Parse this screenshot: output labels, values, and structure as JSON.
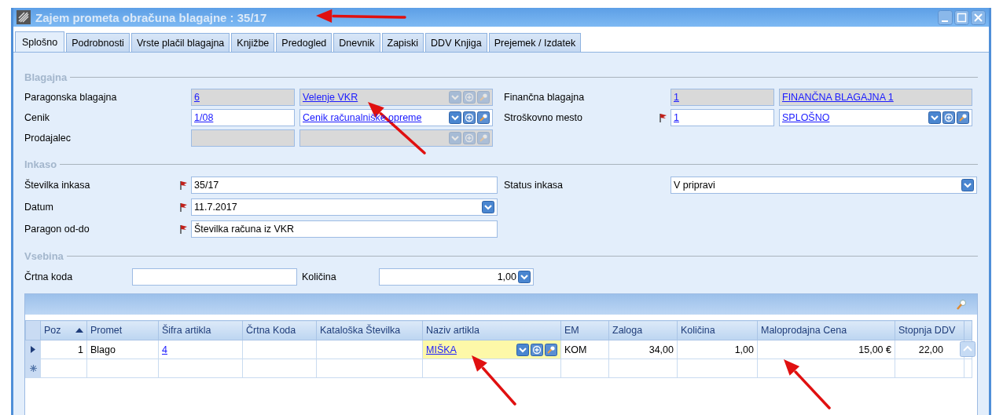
{
  "window": {
    "title": "Zajem prometa obračuna blagajne : 35/17"
  },
  "tabs": [
    {
      "label": "Splošno",
      "selected": true
    },
    {
      "label": "Podrobnosti",
      "selected": false
    },
    {
      "label": "Vrste plačil blagajna",
      "selected": false
    },
    {
      "label": "Knjižbe",
      "selected": false
    },
    {
      "label": "Predogled",
      "selected": false
    },
    {
      "label": "Dnevnik",
      "selected": false
    },
    {
      "label": "Zapiski",
      "selected": false
    },
    {
      "label": "DDV Knjiga",
      "selected": false
    },
    {
      "label": "Prejemek / Izdatek",
      "selected": false
    }
  ],
  "blagajna": {
    "title": "Blagajna",
    "fields": [
      {
        "label": "Paragonska blagajna",
        "required": false,
        "code": {
          "value": "6",
          "disabled": true
        },
        "name": {
          "value": "Velenje VKR",
          "disabled": true,
          "buttons": true
        }
      },
      {
        "label": "Finančna blagajna",
        "required": false,
        "code": {
          "value": "1",
          "disabled": true
        },
        "name": {
          "value": "FINANČNA BLAGAJNA 1",
          "disabled": true,
          "buttons": false
        }
      },
      {
        "label": "Cenik",
        "required": false,
        "code": {
          "value": "1/08",
          "disabled": false
        },
        "name": {
          "value": "Cenik računalniške opreme",
          "disabled": false,
          "buttons": true
        }
      },
      {
        "label": "Stroškovno mesto",
        "required": true,
        "code": {
          "value": "1",
          "disabled": false
        },
        "name": {
          "value": "SPLOŠNO",
          "disabled": false,
          "buttons": true
        }
      },
      {
        "label": "Prodajalec",
        "required": false,
        "code": {
          "disabled": true
        },
        "name": {
          "disabled": true,
          "buttons": true
        }
      }
    ]
  },
  "inkaso": {
    "title": "Inkaso",
    "left": [
      {
        "label": "Številka inkasa",
        "required": true,
        "kind": "text",
        "value": "35/17"
      },
      {
        "label": "Datum",
        "required": true,
        "kind": "dropdown",
        "value": "11.7.2017"
      },
      {
        "label": "Paragon od-do",
        "required": true,
        "kind": "text",
        "value": "Številka računa iz VKR"
      }
    ],
    "right": [
      {
        "label": "Status inkasa",
        "kind": "dropdown",
        "value": "V pripravi"
      }
    ]
  },
  "vsebina": {
    "title": "Vsebina",
    "barcode": {
      "label": "Črtna koda"
    },
    "quantity": {
      "label": "Količina",
      "value": "1,00"
    }
  },
  "table": {
    "columns": [
      {
        "label": "Poz",
        "sorted": true,
        "kind": "number"
      },
      {
        "label": "Promet",
        "sorted": false,
        "kind": "text"
      },
      {
        "label": "Šifra artikla",
        "sorted": false,
        "kind": "text"
      },
      {
        "label": "Črtna Koda",
        "sorted": false,
        "kind": "text"
      },
      {
        "label": "Kataloška Številka",
        "sorted": false,
        "kind": "text"
      },
      {
        "label": "Naziv artikla",
        "sorted": false,
        "kind": "text"
      },
      {
        "label": "EM",
        "sorted": false,
        "kind": "text"
      },
      {
        "label": "Zaloga",
        "sorted": false,
        "kind": "number"
      },
      {
        "label": "Količina",
        "sorted": false,
        "kind": "number"
      },
      {
        "label": "Maloprodajna Cena",
        "sorted": false,
        "kind": "number"
      },
      {
        "label": "Stopnja DDV",
        "sorted": false,
        "kind": "number"
      }
    ],
    "rows": [
      {
        "kind": "current",
        "cells": [
          {
            "value": "1"
          },
          {
            "value": "Blago"
          },
          {
            "value": "4",
            "link": true
          },
          {},
          {},
          {
            "value": "MIŠKA",
            "link": true,
            "editing": true
          },
          {
            "value": "KOM"
          },
          {
            "value": "34,00"
          },
          {
            "value": "1,00"
          },
          {
            "value": "15,00 €"
          },
          {
            "value": "22,00"
          }
        ]
      },
      {
        "kind": "new",
        "cells": [
          {},
          {},
          {},
          {},
          {},
          {},
          {},
          {},
          {},
          {},
          {}
        ]
      }
    ]
  }
}
